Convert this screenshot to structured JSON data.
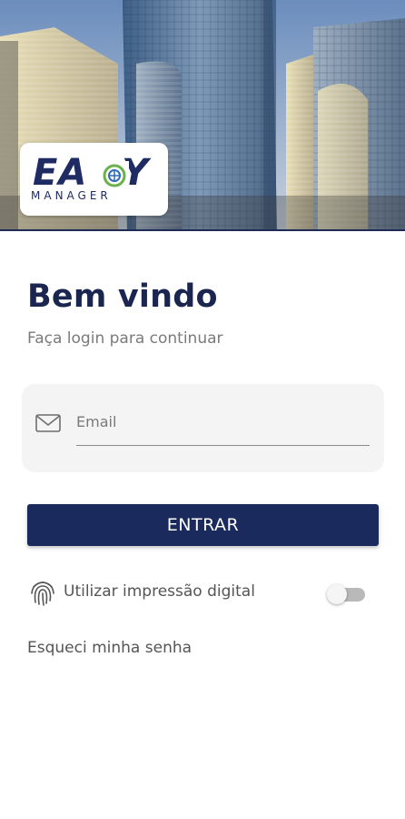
{
  "header": {
    "logo_word": "EASY",
    "logo_sub": "MANAGER",
    "brand_color": "#1f2b63",
    "background": "office buildings photo"
  },
  "welcome": {
    "title": "Bem vindo",
    "subtitle": "Faça login para continuar"
  },
  "email": {
    "placeholder": "Email",
    "value": "",
    "icon": "mail-icon"
  },
  "login_button": {
    "label": "ENTRAR",
    "color": "#1a2a5c"
  },
  "fingerprint": {
    "label": "Utilizar impressão digital",
    "enabled": false,
    "icon": "fingerprint-icon"
  },
  "forgot_password": {
    "label": "Esqueci minha senha"
  }
}
